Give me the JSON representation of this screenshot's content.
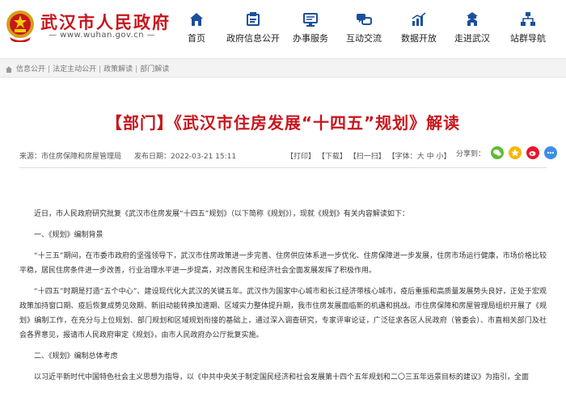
{
  "header": {
    "site_title": "武汉市人民政府",
    "site_url": "— www.wuhan.gov.cn —",
    "brand_color": "#c8161d",
    "nav": [
      {
        "label": "首页",
        "icon": "home-icon"
      },
      {
        "label": "政府信息公开",
        "icon": "info-public-icon"
      },
      {
        "label": "办事服务",
        "icon": "service-icon"
      },
      {
        "label": "互动交流",
        "icon": "interaction-icon"
      },
      {
        "label": "数据开放",
        "icon": "data-icon"
      },
      {
        "label": "走进武汉",
        "icon": "city-icon"
      },
      {
        "label": "站群导航",
        "icon": "sitemap-icon"
      }
    ]
  },
  "breadcrumb": [
    "信息公开",
    "法定主动公开",
    "政策解读",
    "部门解读"
  ],
  "article": {
    "title": "【部门】《武汉市住房发展“十四五”规划》解读",
    "source": "来源：市住房保障和房屋管理局",
    "date": "发布日期：2022-03-21 15:11",
    "tools": [
      "【打印】",
      "【下载】",
      "【扫一扫】",
      "【字体：",
      "大",
      "中",
      "小",
      "】"
    ],
    "share_label": "分享到：",
    "share_icons": [
      "wechat-icon",
      "qzone-icon",
      "weibo-icon",
      "more-share-icon"
    ],
    "paragraphs": [
      "近日，市人民政府研究批复《武汉市住房发展“十四五”规划》（以下简称《规划》），现就《规划》有关内容解读如下：",
      "一、《规划》编制背景",
      "“十三五”期间，在市委市政府的坚强领导下，武汉市住房政策进一步完善、住房供应体系进一步优化、住房保障进一步发展，住房市场运行健康，市场价格比较平稳，居民住房条件进一步改善，行业治理水平进一步提高，对改善民生和经济社会全面发展发挥了积极作用。",
      "“十四五”时期是打造“五个中心”、建设现代化大武汉的关键五年。武汉作为国家中心城市和长江经济带核心城市，疫后重振和高质量发展势头良好，正处于宏观政策加持窗口期、疫后恢复成势见效期、新旧动能转换加速期、区域实力整体提升期，我市住房发展面临新的机遇和挑战。市住房保障和房屋管理局组织开展了《规划》编制工作，在充分与上位规划、部门规划和区域规划衔接的基础上，通过深入调查研究，专家评审论证，广泛征求各区人民政府（管委会）、市直相关部门及社会各界意见，报请市人民政府审定《规划》，由市人民政府办公厅批复实施。",
      "二、《规划》编制总体考虑",
      "以习近平新时代中国特色社会主义思想为指导，以《中共中央关于制定国民经济和社会发展第十四个五年规划和二〇三五年远景目标的建议》为指引，全面"
    ]
  }
}
